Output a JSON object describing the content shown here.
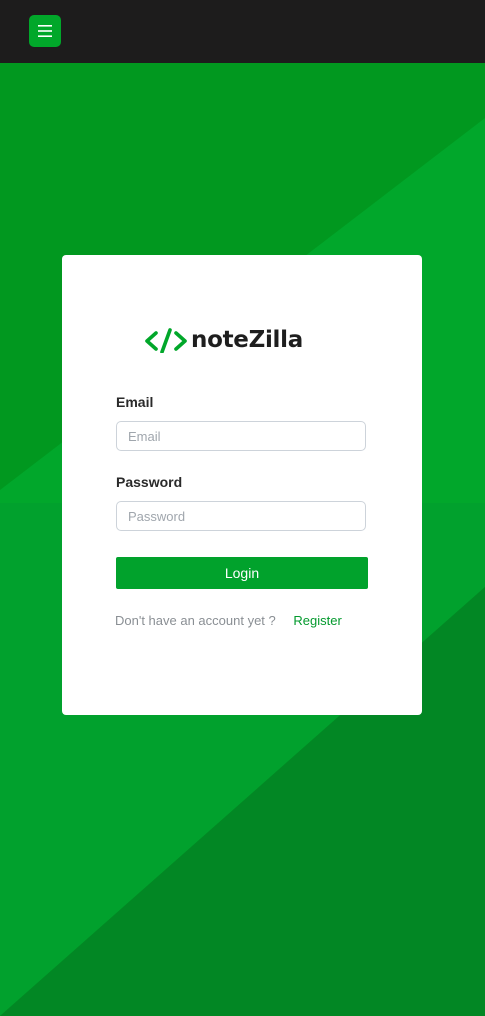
{
  "header": {
    "menu_icon": "hamburger-icon"
  },
  "brand": {
    "logo_mark": "</>",
    "name": "noteZilla",
    "accent_color": "#01a72a"
  },
  "form": {
    "email": {
      "label": "Email",
      "placeholder": "Email",
      "value": ""
    },
    "password": {
      "label": "Password",
      "placeholder": "Password",
      "value": ""
    },
    "login_label": "Login",
    "register_prompt": "Don't have an account yet ?",
    "register_link": "Register"
  },
  "colors": {
    "topbar": "#1d1c1c",
    "background": "#01981f",
    "card": "#ffffff",
    "button": "#01a22c"
  }
}
